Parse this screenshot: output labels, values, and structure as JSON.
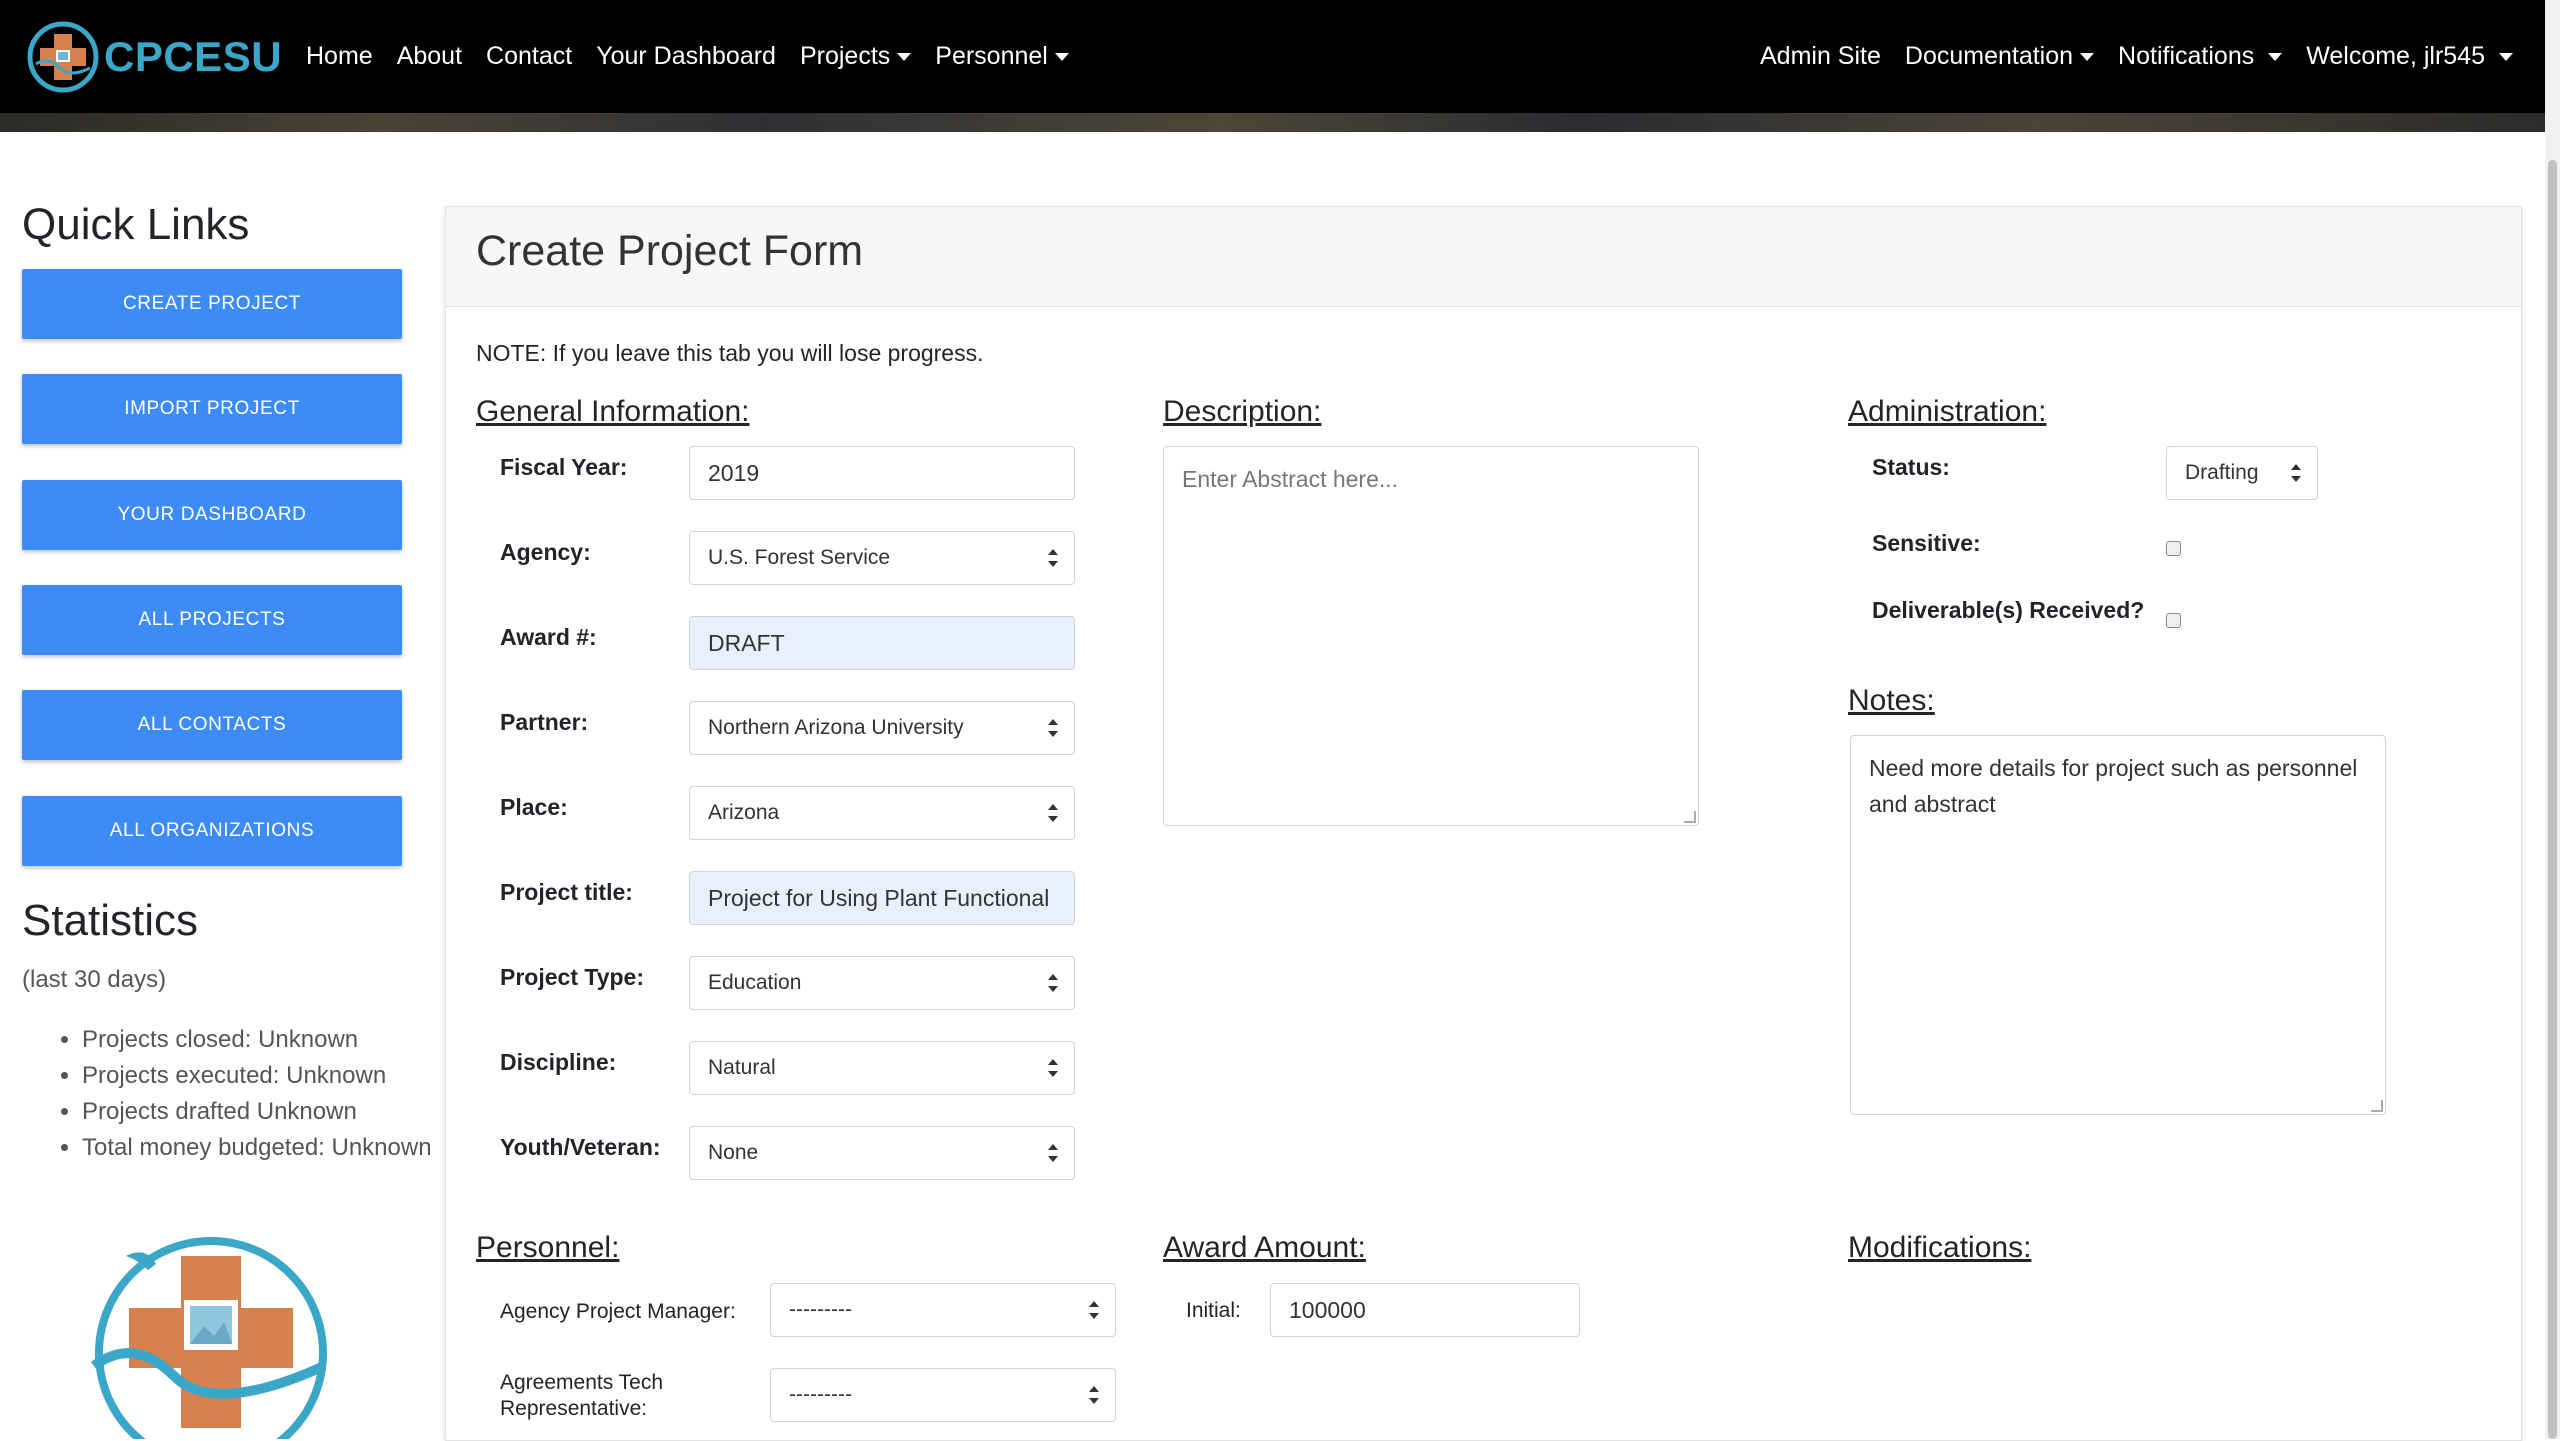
{
  "nav": {
    "brand": "CPCESU",
    "left": [
      "Home",
      "About",
      "Contact",
      "Your Dashboard",
      "Projects",
      "Personnel"
    ],
    "right": [
      "Admin Site",
      "Documentation",
      "Notifications",
      "Welcome, jlr545"
    ]
  },
  "sidebar": {
    "quick_links_title": "Quick Links",
    "buttons": [
      "CREATE PROJECT",
      "IMPORT PROJECT",
      "YOUR DASHBOARD",
      "ALL PROJECTS",
      "ALL CONTACTS",
      "ALL ORGANIZATIONS"
    ],
    "stats_title": "Statistics",
    "stats_subtitle": "(last 30 days)",
    "stats": [
      "Projects closed: Unknown",
      "Projects executed: Unknown",
      "Projects drafted Unknown",
      "Total money budgeted: Unknown"
    ]
  },
  "form": {
    "title": "Create Project Form",
    "note": "NOTE: If you leave this tab you will lose progress.",
    "general": {
      "heading": "General Information:",
      "fields": [
        {
          "label": "Fiscal Year:",
          "value": "2019"
        },
        {
          "label": "Agency:",
          "value": "U.S. Forest Service"
        },
        {
          "label": "Award #:",
          "value": "DRAFT"
        },
        {
          "label": "Partner:",
          "value": "Northern Arizona University"
        },
        {
          "label": "Place:",
          "value": "Arizona"
        },
        {
          "label": "Project title:",
          "value": "Project for Using Plant Functional"
        },
        {
          "label": "Project Type:",
          "value": "Education"
        },
        {
          "label": "Discipline:",
          "value": "Natural"
        },
        {
          "label": "Youth/Veteran:",
          "value": "None"
        }
      ]
    },
    "description": {
      "heading": "Description:",
      "placeholder": "Enter Abstract here..."
    },
    "administration": {
      "heading": "Administration:",
      "status_label": "Status:",
      "status_value": "Drafting",
      "sensitive_label": "Sensitive:",
      "deliverables_label": "Deliverable(s) Received?"
    },
    "notes": {
      "heading": "Notes:",
      "value": "Need more details for project such as personnel and abstract"
    },
    "personnel": {
      "heading": "Personnel:",
      "manager_label": "Agency Project Manager:",
      "manager_value": "---------",
      "tech_label": "Agreements Tech Representative:",
      "tech_value": "---------"
    },
    "award": {
      "heading": "Award Amount:",
      "initial_label": "Initial:",
      "initial_value": "100000"
    },
    "modifications": {
      "heading": "Modifications:"
    }
  }
}
